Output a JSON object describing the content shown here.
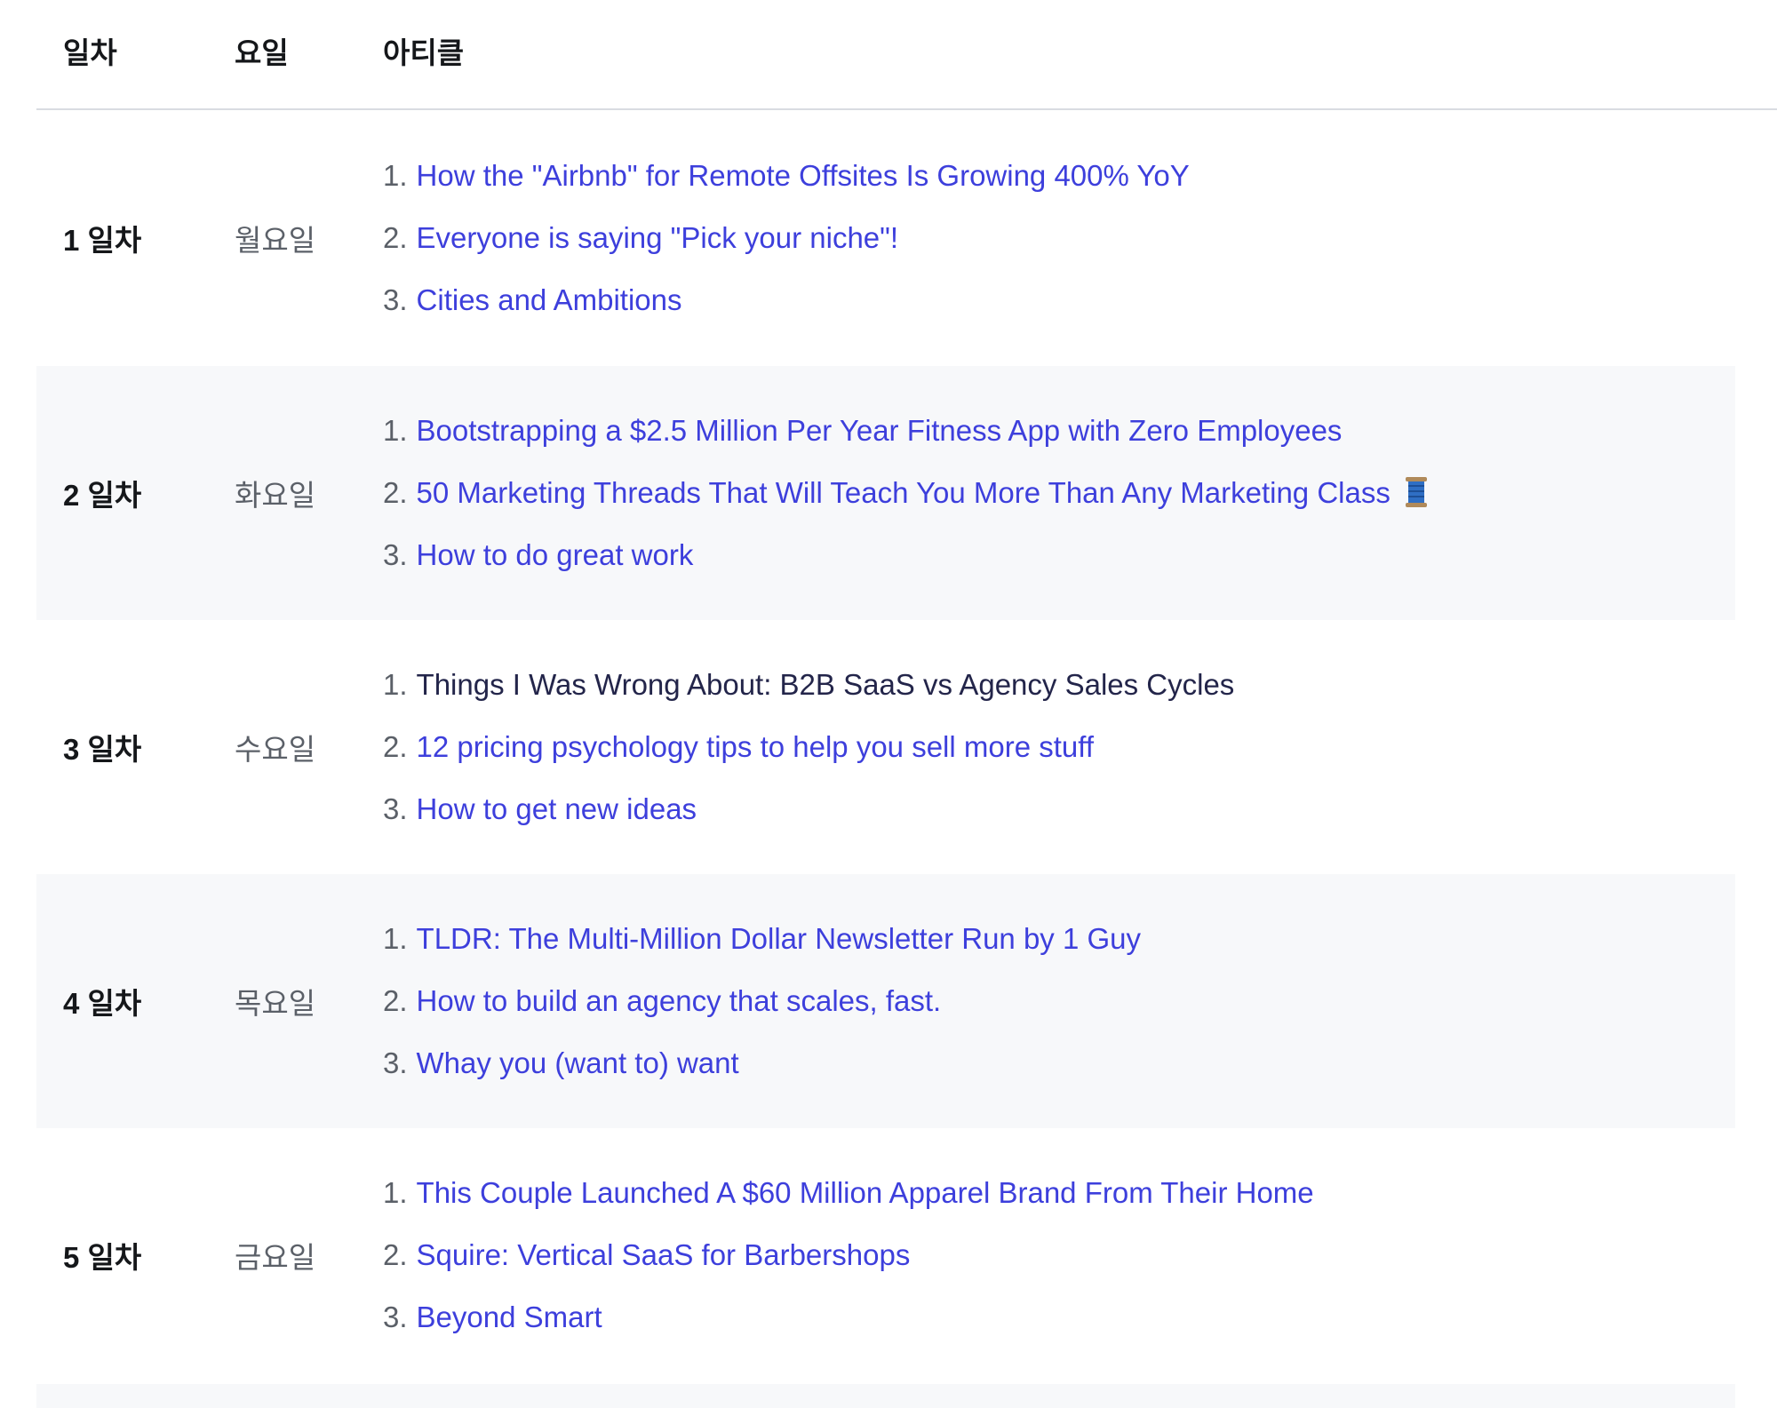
{
  "table": {
    "headers": {
      "day": "일차",
      "weekday": "요일",
      "articles": "아티클"
    },
    "rows": [
      {
        "day": "1 일차",
        "weekday": "월요일",
        "articles": [
          {
            "num": "1.",
            "title": "How the \"Airbnb\" for Remote Offsites Is Growing 400% YoY"
          },
          {
            "num": "2.",
            "title": "Everyone is saying \"Pick your niche\"!"
          },
          {
            "num": "3.",
            "title": "Cities and Ambitions"
          }
        ]
      },
      {
        "day": "2 일차",
        "weekday": "화요일",
        "articles": [
          {
            "num": "1.",
            "title": "Bootstrapping a $2.5 Million Per Year Fitness App with Zero Employees"
          },
          {
            "num": "2.",
            "title": "50 Marketing Threads That Will Teach You More Than Any Marketing Class",
            "emoji": "thread-spool-icon"
          },
          {
            "num": "3.",
            "title": "How to do great work"
          }
        ]
      },
      {
        "day": "3 일차",
        "weekday": "수요일",
        "articles": [
          {
            "num": "1.",
            "title": "Things I Was Wrong About: B2B SaaS vs Agency Sales Cycles"
          },
          {
            "num": "2.",
            "title": "12 pricing psychology tips to help you sell more stuff"
          },
          {
            "num": "3.",
            "title": "How to get new ideas"
          }
        ]
      },
      {
        "day": "4 일차",
        "weekday": "목요일",
        "articles": [
          {
            "num": "1.",
            "title": "TLDR: The Multi-Million Dollar Newsletter Run by 1 Guy"
          },
          {
            "num": "2.",
            "title": "How to build an agency that scales, fast."
          },
          {
            "num": "3.",
            "title": "Whay you (want to) want"
          }
        ]
      },
      {
        "day": "5 일차",
        "weekday": "금요일",
        "articles": [
          {
            "num": "1.",
            "title": "This Couple Launched A $60 Million Apparel Brand From Their Home"
          },
          {
            "num": "2.",
            "title": "Squire: Vertical SaaS for Barbershops"
          },
          {
            "num": "3.",
            "title": "Beyond Smart"
          }
        ]
      }
    ]
  },
  "colors": {
    "link": "#3d3fdc",
    "plain_text": "#23254a",
    "alt_row_bg": "#f7f8fa",
    "header_border": "#d9dce1"
  }
}
